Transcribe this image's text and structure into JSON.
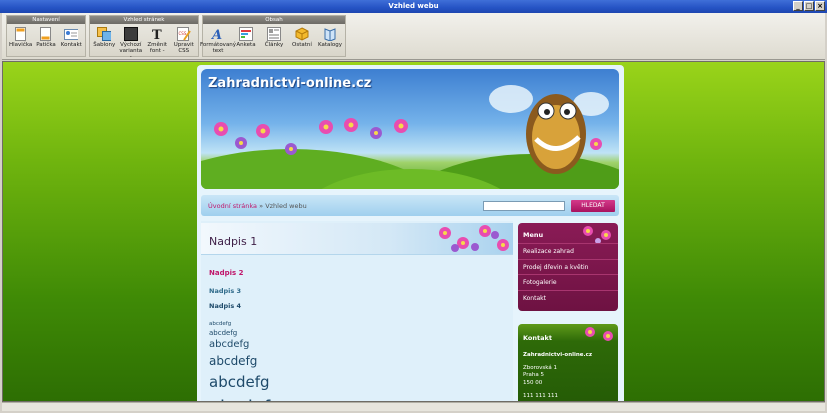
{
  "window": {
    "title": "Vzhled webu"
  },
  "ribbon": {
    "groups": [
      {
        "label": "Nastavení",
        "tools": [
          "Hlavička",
          "Patička",
          "Kontakt"
        ]
      },
      {
        "label": "Vzhled stránek",
        "tools": [
          "Šablony",
          "Výchozí\nvarianta -",
          "Změnit\nfont -",
          "Upravit\nCSS"
        ]
      },
      {
        "label": "Obsah",
        "tools": [
          "Formátovaný\ntext",
          "Anketa",
          "Články",
          "Ostatní",
          "Katalogy"
        ]
      }
    ]
  },
  "site": {
    "title": "Zahradnictvi-online.cz",
    "breadcrumb": {
      "home": "Úvodní stránka",
      "sep": "»",
      "current": "Vzhled webu"
    },
    "search_button": "HLEDAT",
    "headings": {
      "h1": "Nadpis 1",
      "h2": "Nadpis 2",
      "h3": "Nadpis 3",
      "h4": "Nadpis 4"
    },
    "samples": [
      "abcdefg",
      "abcdefg",
      "abcdefg",
      "abcdefg",
      "abcdefg",
      "abcdefg"
    ],
    "menu": {
      "title": "Menu",
      "items": [
        "Realizace zahrad",
        "Prodej dřevin a květin",
        "Fotogalerie",
        "Kontakt"
      ]
    },
    "contact": {
      "title": "Kontakt",
      "company": "Zahradnictvi-online.cz",
      "street": "Zborovská 1",
      "city": "Praha 5",
      "zip": "150 00",
      "phone": "111 111 111"
    }
  }
}
